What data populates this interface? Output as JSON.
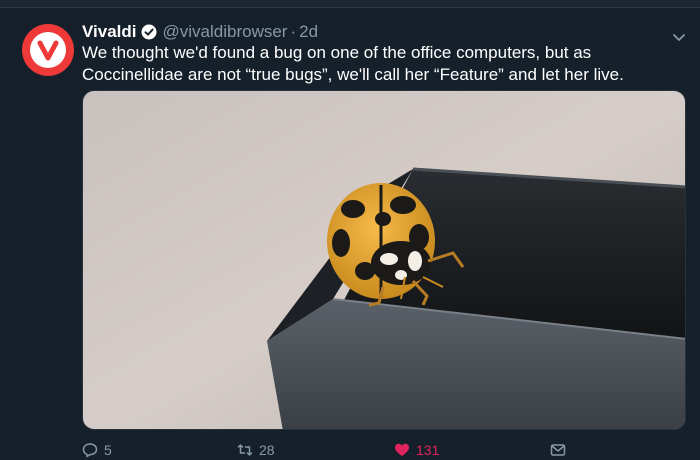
{
  "tweet": {
    "author_name": "Vivaldi",
    "handle": "@vivaldibrowser",
    "separator": "·",
    "time": "2d",
    "text": "We thought we'd found a bug on one of the office computers, but as Coccinellidae are not “true bugs”, we'll call her “Feature” and let her live.",
    "verified": true,
    "avatar_color": "#ef3939"
  },
  "media": {
    "icon": "ladybug-photo"
  },
  "actions": {
    "reply_count": "5",
    "retweet_count": "28",
    "like_count": "131",
    "like_color": "#e0245e",
    "liked": true
  },
  "colors": {
    "background": "#15202b",
    "secondary_text": "#8899a6",
    "verified_blue": "#1da1f2"
  }
}
